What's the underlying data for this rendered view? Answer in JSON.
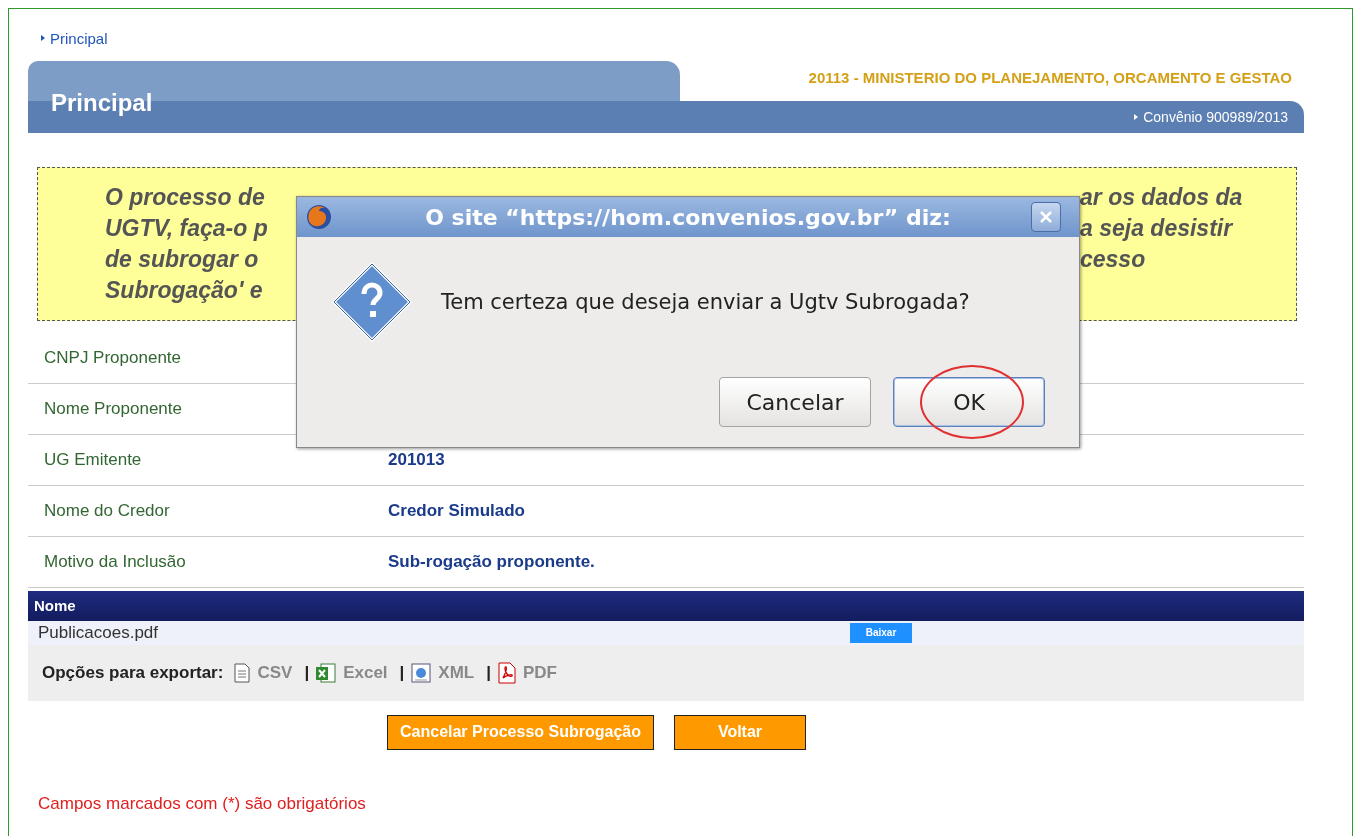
{
  "breadcrumb": {
    "label": "Principal"
  },
  "header": {
    "title": "Principal",
    "organization": "20113 - MINISTERIO DO PLANEJAMENTO, ORCAMENTO E GESTAO",
    "agreement": "Convênio 900989/2013"
  },
  "notice": {
    "lines": [
      {
        "left": "O processo de",
        "right": "ar os dados da"
      },
      {
        "left": "UGTV, faça-o p",
        "right": "a seja desistir"
      },
      {
        "left": "de subrogar o",
        "right": "cesso"
      },
      {
        "left": "Subrogação' e"
      }
    ]
  },
  "fields": [
    {
      "label": "CNPJ Proponente"
    },
    {
      "label": "Nome Proponente"
    },
    {
      "label": "UG Emitente",
      "value": "201013"
    },
    {
      "label": "Nome do Credor",
      "value": "Credor Simulado"
    },
    {
      "label": "Motivo da Inclusão",
      "value": "Sub-rogação proponente."
    }
  ],
  "attachments": {
    "columns": [
      "Nome"
    ],
    "rows": [
      {
        "name": "Publicacoes.pdf",
        "action": "Baixar"
      }
    ]
  },
  "export": {
    "label": "Opções para exportar:",
    "options": [
      {
        "kind": "csv",
        "label": "CSV"
      },
      {
        "kind": "excel",
        "separator": "|",
        "label": "Excel"
      },
      {
        "kind": "xml",
        "separator": "|",
        "label": "XML"
      },
      {
        "kind": "pdf",
        "separator": "|",
        "label": "PDF"
      }
    ]
  },
  "actions": [
    "Cancelar Processo Subrogação",
    "Voltar"
  ],
  "footnote": "Campos marcados com (*) são obrigatórios",
  "dialog": {
    "title": "O site “https://hom.convenios.gov.br” diz:",
    "message": "Tem certeza que deseja enviar a Ugtv Subrogada?",
    "buttons": [
      {
        "label": "Cancelar",
        "selected": false
      },
      {
        "label": "OK",
        "selected": true,
        "circled": true
      }
    ]
  }
}
